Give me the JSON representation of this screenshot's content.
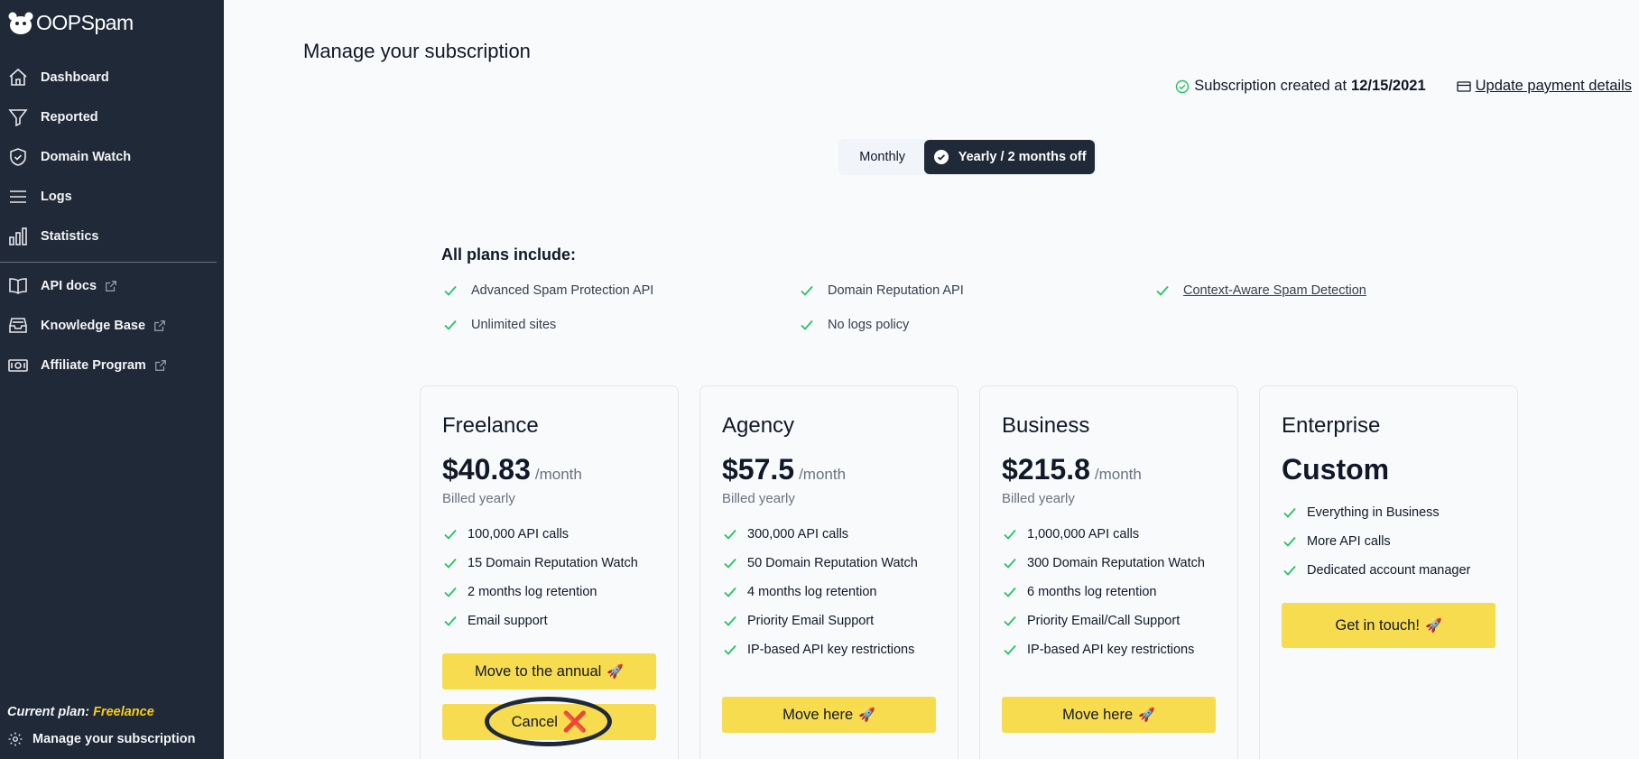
{
  "app": {
    "logo_text": "OOPSpam"
  },
  "sidebar": {
    "items": [
      {
        "label": "Dashboard",
        "icon": "home-icon"
      },
      {
        "label": "Reported",
        "icon": "funnel-icon"
      },
      {
        "label": "Domain Watch",
        "icon": "shield-check-icon"
      },
      {
        "label": "Logs",
        "icon": "list-icon"
      },
      {
        "label": "Statistics",
        "icon": "bar-chart-icon"
      }
    ],
    "external": [
      {
        "label": "API docs",
        "icon": "book-icon"
      },
      {
        "label": "Knowledge Base",
        "icon": "inbox-stack-icon"
      },
      {
        "label": "Affiliate Program",
        "icon": "cash-icon"
      }
    ],
    "current_plan_label": "Current plan:",
    "current_plan_name": "Freelance",
    "manage_label": "Manage your subscription"
  },
  "main": {
    "title": "Manage your subscription",
    "subscription_created_label": "Subscription created at",
    "subscription_created_date": "12/15/2021",
    "update_payment_label": "Update payment details",
    "toggle": {
      "monthly": "Monthly",
      "yearly": "Yearly / 2 months off",
      "selected": "yearly"
    },
    "includes_title": "All plans include:",
    "includes": [
      "Advanced Spam Protection API",
      "Domain Reputation API",
      "Context-Aware Spam Detection",
      "Unlimited sites",
      "No logs policy"
    ]
  },
  "plans": [
    {
      "name": "Freelance",
      "price": "$40.83",
      "per": "/month",
      "billed": "Billed yearly",
      "features": [
        "100,000 API calls",
        "15 Domain Reputation Watch",
        "2 months log retention",
        "Email support"
      ],
      "primary_button": "Move to the annual",
      "secondary_button": "Cancel"
    },
    {
      "name": "Agency",
      "price": "$57.5",
      "per": "/month",
      "billed": "Billed yearly",
      "features": [
        "300,000 API calls",
        "50 Domain Reputation Watch",
        "4 months log retention",
        "Priority Email Support",
        "IP-based API key restrictions"
      ],
      "button": "Move here"
    },
    {
      "name": "Business",
      "price": "$215.8",
      "per": "/month",
      "billed": "Billed yearly",
      "features": [
        "1,000,000 API calls",
        "300 Domain Reputation Watch",
        "6 months log retention",
        "Priority Email/Call Support",
        "IP-based API key restrictions"
      ],
      "button": "Move here"
    },
    {
      "name": "Enterprise",
      "price": "Custom",
      "features": [
        "Everything in Business",
        "More API calls",
        "Dedicated account manager"
      ],
      "button": "Get in touch!"
    }
  ],
  "emoji": {
    "rocket": "🚀",
    "cross": "❌"
  },
  "colors": {
    "sidebar_bg": "#1f2937",
    "accent_yellow": "#f8dc50",
    "check_green": "#22c55e",
    "plan_highlight": "#facc15"
  }
}
